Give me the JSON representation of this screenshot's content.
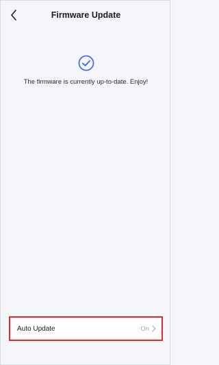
{
  "header": {
    "title": "Firmware Update",
    "back_icon": "chevron-left-icon"
  },
  "status": {
    "icon": "check-circle-icon",
    "message": "The firmware is currently up-to-date. Enjoy!",
    "accent_color": "#4a6cf7"
  },
  "settings": {
    "auto_update": {
      "label": "Auto Update",
      "value": "On",
      "chevron_icon": "chevron-right-icon"
    }
  },
  "highlight_color": "#e0282e"
}
